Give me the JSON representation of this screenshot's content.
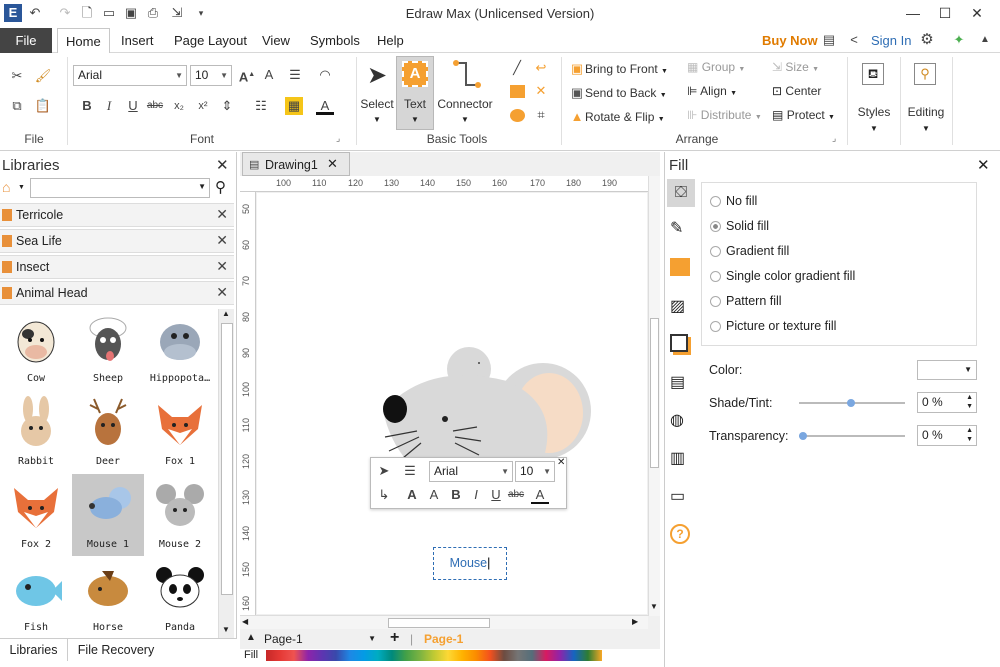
{
  "window": {
    "title": "Edraw Max (Unlicensed Version)"
  },
  "menu": {
    "file": "File",
    "tabs": [
      "Home",
      "Insert",
      "Page Layout",
      "View",
      "Symbols",
      "Help"
    ],
    "buy_now": "Buy Now",
    "sign_in": "Sign In"
  },
  "ribbon": {
    "font_family": "Arial",
    "font_size": "10",
    "groups": {
      "file": "File",
      "font": "Font",
      "basic_tools": "Basic Tools",
      "arrange": "Arrange"
    },
    "tools": {
      "select": "Select",
      "text": "Text",
      "connector": "Connector"
    },
    "arrange": {
      "bring_front": "Bring to Front",
      "send_back": "Send to Back",
      "rotate_flip": "Rotate & Flip",
      "group": "Group",
      "align": "Align",
      "distribute": "Distribute",
      "size": "Size",
      "center": "Center",
      "protect": "Protect"
    },
    "styles": "Styles",
    "editing": "Editing"
  },
  "libraries": {
    "title": "Libraries",
    "items": [
      "Terricole",
      "Sea Life",
      "Insect",
      "Animal Head"
    ],
    "shapes": [
      "Cow",
      "Sheep",
      "Hippopota…",
      "Rabbit",
      "Deer",
      "Fox 1",
      "Fox 2",
      "Mouse 1",
      "Mouse 2",
      "Fish",
      "Horse",
      "Panda"
    ],
    "bottom_tabs": [
      "Libraries",
      "File Recovery"
    ]
  },
  "document": {
    "tab": "Drawing1",
    "ruler_top": [
      "100",
      "110",
      "120",
      "130",
      "140",
      "150",
      "160",
      "170",
      "180",
      "190"
    ],
    "ruler_left": [
      "50",
      "60",
      "70",
      "80",
      "90",
      "100",
      "110",
      "120",
      "130",
      "140",
      "150",
      "160"
    ],
    "text_label": "Mouse",
    "page_selector": "Page-1",
    "page_tab": "Page-1",
    "fill_label": "Fill",
    "mini_font": "Arial",
    "mini_size": "10"
  },
  "fill_panel": {
    "title": "Fill",
    "options": [
      "No fill",
      "Solid fill",
      "Gradient fill",
      "Single color gradient fill",
      "Pattern fill",
      "Picture or texture fill"
    ],
    "selected": "Solid fill",
    "color_label": "Color:",
    "shade_label": "Shade/Tint:",
    "shade_value": "0 %",
    "transparency_label": "Transparency:",
    "transparency_value": "0 %"
  },
  "colors": {
    "accent": "#2e6db4",
    "orange": "#f5a031",
    "buy": "#e07b00",
    "file_tab": "#444444"
  }
}
